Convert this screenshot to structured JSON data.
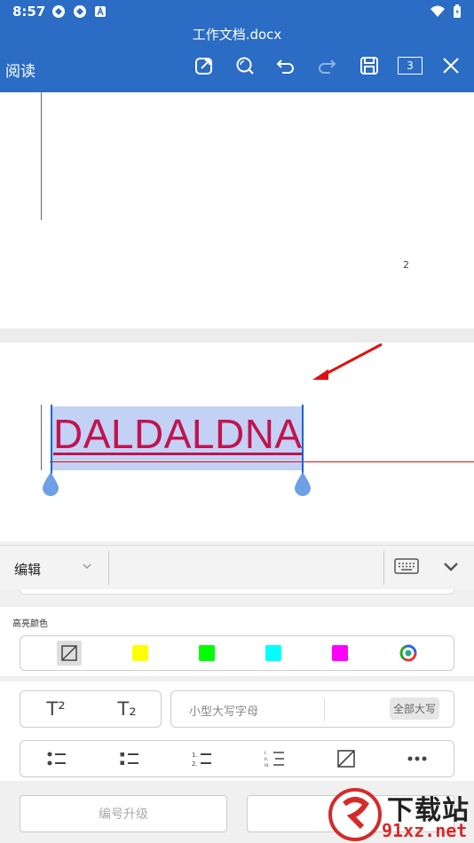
{
  "status_bar": {
    "time": "8:57"
  },
  "header": {
    "title": "工作文档.docx",
    "read_mode_label": "阅读",
    "page_count": "3"
  },
  "document": {
    "page_number": "2",
    "selected_text": "DALDALDNA"
  },
  "edit_bar": {
    "mode_label": "编辑"
  },
  "highlight": {
    "title": "高亮颜色",
    "colors": [
      "none",
      "#ffff00",
      "#00ff00",
      "#00ffff",
      "#ff00ff",
      "more"
    ]
  },
  "font_effects": {
    "superscript": "T²",
    "subscript": "T₂",
    "small_caps_label": "小型大写字母",
    "all_caps_label": "全部大写"
  },
  "numbering": {
    "promote_label": "编号升级"
  },
  "watermark": {
    "brand": "下载站",
    "url": "91xz.net"
  },
  "colors": {
    "appbar": "#2b6cc4",
    "doc_text": "#c0144f",
    "selection": "#c3d1f5"
  }
}
